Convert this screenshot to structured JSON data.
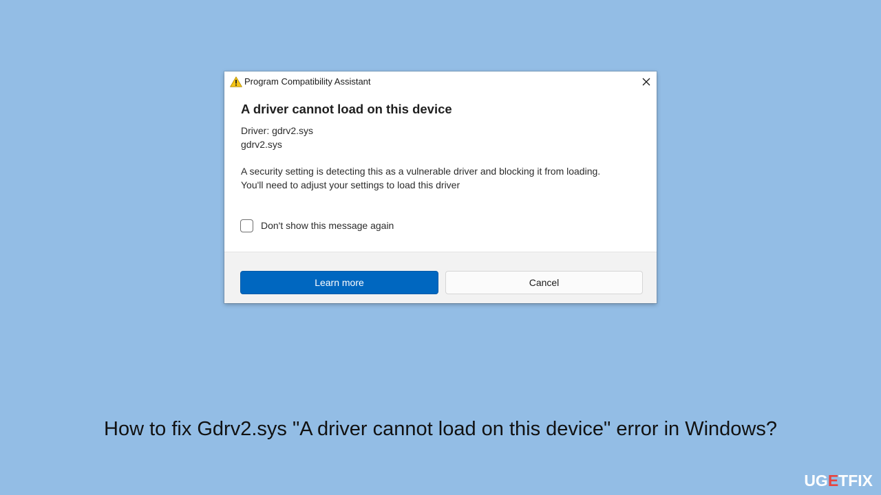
{
  "dialog": {
    "title": "Program Compatibility Assistant",
    "heading": "A driver cannot load on this device",
    "driver_label": "Driver: gdrv2.sys",
    "driver_file": "gdrv2.sys",
    "message_line1": "A security setting is detecting this as a vulnerable driver and blocking it from loading.",
    "message_line2": "You'll need to adjust your settings to load this driver",
    "checkbox_label": "Don't show this message again",
    "checkbox_checked": false,
    "learn_more_label": "Learn more",
    "cancel_label": "Cancel",
    "title_icon": "warning-icon",
    "close_icon": "close-icon"
  },
  "caption": "How to fix Gdrv2.sys \"A driver cannot load on this device\" error in Windows?",
  "logo": {
    "part1": "UG",
    "part2": "E",
    "part3": "TFIX"
  },
  "colors": {
    "background": "#93bde5",
    "primary_button": "#0067c0",
    "warning": "#f5c518",
    "logo_accent": "#e8433e"
  }
}
